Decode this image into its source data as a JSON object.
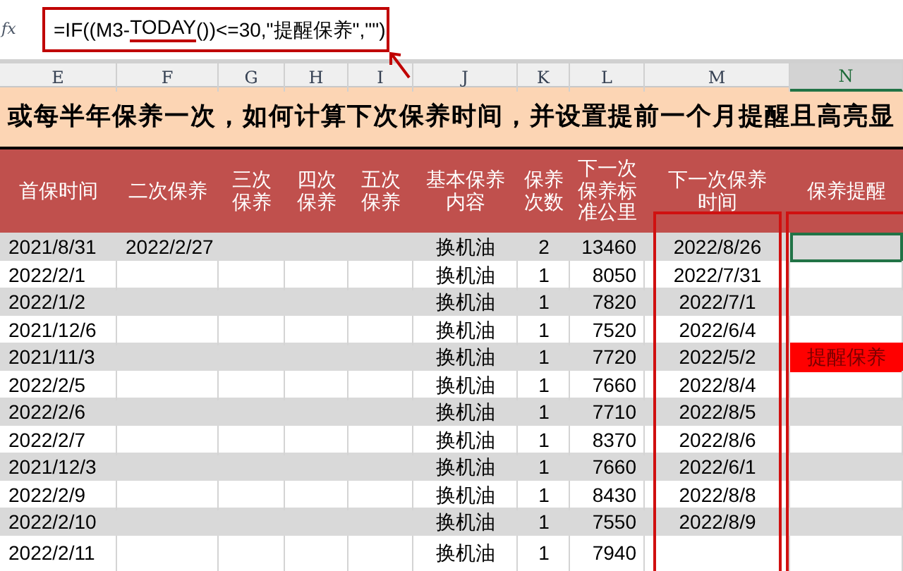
{
  "formula_bar": {
    "label": "fx",
    "formula_start": "=IF((M3-",
    "formula_function": "TODAY",
    "formula_end": "())<=30,\"提醒保养\",\"\")"
  },
  "column_letters": [
    {
      "label": "E",
      "selected": false
    },
    {
      "label": "F",
      "selected": false
    },
    {
      "label": "G",
      "selected": false
    },
    {
      "label": "H",
      "selected": false
    },
    {
      "label": "I",
      "selected": false
    },
    {
      "label": "J",
      "selected": false
    },
    {
      "label": "K",
      "selected": false
    },
    {
      "label": "L",
      "selected": false
    },
    {
      "label": "M",
      "selected": false
    },
    {
      "label": "N",
      "selected": true
    }
  ],
  "title": "或每半年保养一次，如何计算下次保养时间，并设置提前一个月提醒且高亮显",
  "headers": [
    "首保时间",
    "二次保养",
    "三次保养",
    "四次保养",
    "五次保养",
    "基本保养内容",
    "保养次数",
    "下一次保养标准公里",
    "下一次保养时间",
    "保养提醒"
  ],
  "rows": [
    {
      "cells": [
        "2021/8/31",
        "2022/2/27",
        "",
        "",
        "",
        "换机油",
        "2",
        "13460",
        "2022/8/26",
        ""
      ],
      "alert": false,
      "selected": true
    },
    {
      "cells": [
        "2022/2/1",
        "",
        "",
        "",
        "",
        "换机油",
        "1",
        "8050",
        "2022/7/31",
        ""
      ],
      "alert": false,
      "selected": false
    },
    {
      "cells": [
        "2022/1/2",
        "",
        "",
        "",
        "",
        "换机油",
        "1",
        "7820",
        "2022/7/1",
        ""
      ],
      "alert": false,
      "selected": false
    },
    {
      "cells": [
        "2021/12/6",
        "",
        "",
        "",
        "",
        "换机油",
        "1",
        "7520",
        "2022/6/4",
        ""
      ],
      "alert": false,
      "selected": false
    },
    {
      "cells": [
        "2021/11/3",
        "",
        "",
        "",
        "",
        "换机油",
        "1",
        "7720",
        "2022/5/2",
        "提醒保养"
      ],
      "alert": true,
      "selected": false
    },
    {
      "cells": [
        "2022/2/5",
        "",
        "",
        "",
        "",
        "换机油",
        "1",
        "7660",
        "2022/8/4",
        ""
      ],
      "alert": false,
      "selected": false
    },
    {
      "cells": [
        "2022/2/6",
        "",
        "",
        "",
        "",
        "换机油",
        "1",
        "7710",
        "2022/8/5",
        ""
      ],
      "alert": false,
      "selected": false
    },
    {
      "cells": [
        "2022/2/7",
        "",
        "",
        "",
        "",
        "换机油",
        "1",
        "8370",
        "2022/8/6",
        ""
      ],
      "alert": false,
      "selected": false
    },
    {
      "cells": [
        "2021/12/3",
        "",
        "",
        "",
        "",
        "换机油",
        "1",
        "7660",
        "2022/6/1",
        ""
      ],
      "alert": false,
      "selected": false
    },
    {
      "cells": [
        "2022/2/9",
        "",
        "",
        "",
        "",
        "换机油",
        "1",
        "8430",
        "2022/8/8",
        ""
      ],
      "alert": false,
      "selected": false
    },
    {
      "cells": [
        "2022/2/10",
        "",
        "",
        "",
        "",
        "换机油",
        "1",
        "7550",
        "2022/8/9",
        ""
      ],
      "alert": false,
      "selected": false
    },
    {
      "cells": [
        "2022/2/11",
        "",
        "",
        "",
        "",
        "换机油",
        "1",
        "7940",
        "",
        ""
      ],
      "alert": false,
      "selected": false
    }
  ]
}
